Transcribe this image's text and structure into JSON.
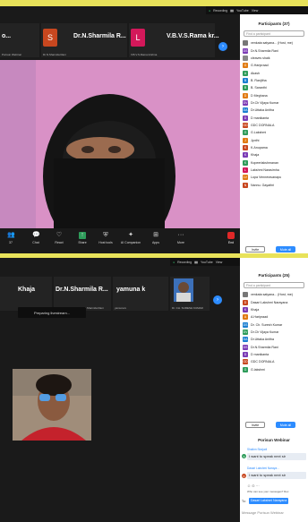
{
  "shot1": {
    "topbar": {
      "recording": "Recording",
      "youtube": "YouTube",
      "view": "View"
    },
    "strip": {
      "tiles": [
        {
          "name": "o...",
          "sub": "Porisun Webinar"
        },
        {
          "avatar": "S",
          "avatar_color": "#c8471f",
          "name": "Dr.N.Sharmila R...",
          "sub": "Dr.N.Sharmila Rani"
        },
        {
          "avatar": "L",
          "avatar_color": "#d3185a",
          "name": "V.B.V.S.Rama kr...",
          "sub": "V.B.V.S.Rama krishna"
        }
      ],
      "left_sub": "Porisun Webinar"
    },
    "toolbar": {
      "items": [
        {
          "icon": "people-icon",
          "label": "Participants",
          "count": "37"
        },
        {
          "icon": "chat-icon",
          "label": "Chat"
        },
        {
          "icon": "heart-icon",
          "label": "React"
        },
        {
          "icon": "share-icon",
          "label": "Share"
        },
        {
          "icon": "host-tools-icon",
          "label": "Host tools"
        },
        {
          "icon": "ai-companion-icon",
          "label": "AI Companion"
        },
        {
          "icon": "apps-icon",
          "label": "Apps"
        },
        {
          "icon": "more-icon",
          "label": "More"
        }
      ],
      "end_label": "End"
    },
    "panel": {
      "title": "Participants (37)",
      "search_placeholder": "Find a participant",
      "participants": [
        {
          "initial": "",
          "color": "#777777",
          "name": "venkata satyana... (Host, me)"
        },
        {
          "initial": "DS",
          "color": "#7b3bb5",
          "name": "Dr.N.Sharmila Rani"
        },
        {
          "initial": "",
          "color": "#888888",
          "name": "cleaves shaik"
        },
        {
          "initial": "G",
          "color": "#e07b12",
          "name": "G.Haripraad"
        },
        {
          "initial": "A",
          "color": "#2e9c5a",
          "name": "Akash"
        },
        {
          "initial": "B",
          "color": "#1b7fd1",
          "name": "B. Ranjitha"
        },
        {
          "initial": "B",
          "color": "#2e9c5a",
          "name": "B. Saranthi"
        },
        {
          "initial": "D",
          "color": "#e07b12",
          "name": "D Meghana"
        },
        {
          "initial": "DV",
          "color": "#7b3bb5",
          "name": "Dr.Ch Vijaya Kumar"
        },
        {
          "initial": "DA",
          "color": "#1b7fd1",
          "name": "Dr.Uttaka Anitha"
        },
        {
          "initial": "D",
          "color": "#7b3bb5",
          "name": "D manikanta"
        },
        {
          "initial": "GD",
          "color": "#c8471f",
          "name": "GDC DORNALA"
        },
        {
          "initial": "G",
          "color": "#2e9c5a",
          "name": "G.Lakshmi"
        },
        {
          "initial": "J",
          "color": "#e07b12",
          "name": "Jyothi"
        },
        {
          "initial": "K",
          "color": "#c8471f",
          "name": "K.Anupama"
        },
        {
          "initial": "K",
          "color": "#7b3bb5",
          "name": "Khaja"
        },
        {
          "initial": "K",
          "color": "#2e9c5a",
          "name": "Kopeerlakshmanan"
        },
        {
          "initial": "L",
          "color": "#d3185a",
          "name": "Lakshmi Narasimha"
        },
        {
          "initial": "LV",
          "color": "#e07b12",
          "name": "Lopa Venneravanapu"
        },
        {
          "initial": "N",
          "color": "#c8471f",
          "name": "Nannu. Gayathri"
        }
      ],
      "invite_label": "Invite",
      "mute_all_label": "Mute all"
    }
  },
  "shot2": {
    "topbar": {
      "recording": "Recording",
      "youtube": "YouTube",
      "view": "View"
    },
    "strip": {
      "tiles": [
        {
          "name": "Khaja",
          "sub": ""
        },
        {
          "name": "Dr.N.Sharmila R...",
          "sub": "Dr.N.Sharmila Rani"
        },
        {
          "name": "yamuna k",
          "sub": "yamuna k"
        },
        {
          "name": "",
          "sub": "Dr. CH. SURESH KUMAR"
        }
      ]
    },
    "preparing_text": "Preparing livestream...",
    "panel": {
      "title": "Participants (25)",
      "search_placeholder": "Find a participant",
      "participants": [
        {
          "initial": "",
          "color": "#777777",
          "name": "venkata satyana... (Host, me)"
        },
        {
          "initial": "D",
          "color": "#c8471f",
          "name": "Dasari Lakshmi Narayana"
        },
        {
          "initial": "K",
          "color": "#7b3bb5",
          "name": "Khaja"
        },
        {
          "initial": "A",
          "color": "#e07b12",
          "name": "A.Haripraad"
        },
        {
          "initial": "DS",
          "color": "#1b7fd1",
          "name": "Dr. Ch. Suresh Kumar"
        },
        {
          "initial": "DV",
          "color": "#2e9c5a",
          "name": "Dr.Ch Vijaya Kumar"
        },
        {
          "initial": "DA",
          "color": "#1b7fd1",
          "name": "Dr.Uttaka Anitha"
        },
        {
          "initial": "DS",
          "color": "#7b3bb5",
          "name": "Dr.N.Sharmila Rani"
        },
        {
          "initial": "D",
          "color": "#7b3bb5",
          "name": "D manikanta"
        },
        {
          "initial": "GD",
          "color": "#c8471f",
          "name": "GDC DORNALA"
        },
        {
          "initial": "G",
          "color": "#2e9c5a",
          "name": "G.lakshmi"
        }
      ],
      "invite_label": "Invite",
      "mute_all_label": "Mute all"
    },
    "chat": {
      "title": "Porisun Webinar",
      "messages": [
        {
          "from": "Shaikm Sirajudi",
          "time": "5:41",
          "avatar_color": "#2e9c5a",
          "initial": "S",
          "text": "I want to speak next sir"
        },
        {
          "from": "Dasari Lakshmi Naraya...",
          "time": "to You",
          "avatar_color": "#c8471f",
          "initial": "D",
          "text": "I want to speak next sir"
        }
      ],
      "who_can_see": "Who can see your messages? Rec",
      "to_label": "To:",
      "to_value": "Dasari Lakshmi Narayana",
      "input_placeholder": "Message Porisun Webinar"
    }
  }
}
